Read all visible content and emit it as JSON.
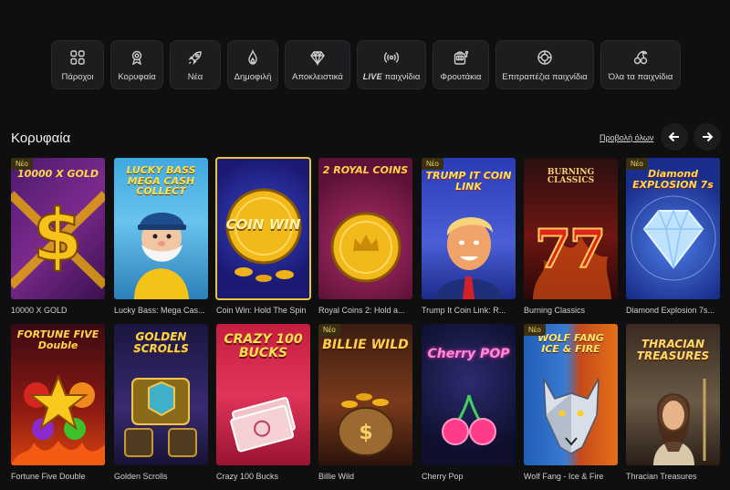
{
  "categories": [
    {
      "label": "Πάροχοι",
      "icon": "grid-icon"
    },
    {
      "label": "Κορυφαία",
      "icon": "medal-icon"
    },
    {
      "label": "Νέα",
      "icon": "rocket-icon"
    },
    {
      "label": "Δημοφιλή",
      "icon": "flame-icon"
    },
    {
      "label": "Αποκλειστικά",
      "icon": "diamond-icon"
    },
    {
      "label_live": "LIVE",
      "label": "παιχνίδια",
      "icon": "broadcast-icon"
    },
    {
      "label": "Φρουτάκια",
      "icon": "slot-machine-icon"
    },
    {
      "label": "Επιτραπέζια παιχνίδια",
      "icon": "chip-icon"
    },
    {
      "label": "Όλα τα παιχνίδια",
      "icon": "cherries-icon"
    }
  ],
  "section": {
    "title": "Κορυφαία",
    "view_all": "Προβολή όλων"
  },
  "badge_text": "Νέο",
  "games_row1": [
    {
      "caption": "10000 X GOLD",
      "logo": "10000 X GOLD",
      "new": true
    },
    {
      "caption": "Lucky Bass: Mega Cas...",
      "logo": "LUCKY BASS MEGA CASH COLLECT",
      "new": false
    },
    {
      "caption": "Coin Win: Hold The Spin",
      "logo": "COIN WIN",
      "new": false
    },
    {
      "caption": "Royal Coins 2: Hold a...",
      "logo": "2 ROYAL COINS",
      "new": false
    },
    {
      "caption": "Trump It Coin Link: R...",
      "logo": "TRUMP IT COIN LINK",
      "new": true
    },
    {
      "caption": "Burning Classics",
      "logo": "BURNING CLASSICS",
      "new": false
    },
    {
      "caption": "Diamond Explosion 7s...",
      "logo": "Diamond EXPLOSION 7s",
      "new": true
    }
  ],
  "games_row2": [
    {
      "caption": "Fortune Five Double",
      "logo": "FORTUNE FIVE Double",
      "new": false
    },
    {
      "caption": "Golden Scrolls",
      "logo": "GOLDEN SCROLLS",
      "new": false
    },
    {
      "caption": "Crazy 100 Bucks",
      "logo": "CRAZY 100 BUCKS",
      "new": false
    },
    {
      "caption": "Billie Wild",
      "logo": "BILLIE WILD",
      "new": true
    },
    {
      "caption": "Cherry Pop",
      "logo": "Cherry POP",
      "new": false
    },
    {
      "caption": "Wolf Fang - Ice & Fire",
      "logo": "WOLF FANG ICE & FIRE",
      "new": true
    },
    {
      "caption": "Thracian Treasures",
      "logo": "THRACIAN TREASURES",
      "new": false
    }
  ]
}
